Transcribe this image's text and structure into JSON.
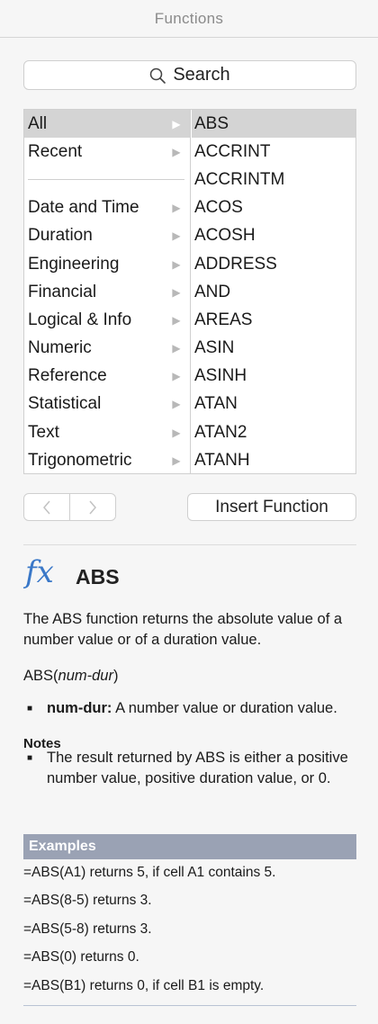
{
  "panel": {
    "title": "Functions"
  },
  "search": {
    "label": "Search",
    "icon": "search-icon"
  },
  "categories": [
    {
      "label": "All",
      "selected": true
    },
    {
      "label": "Recent",
      "selected": false
    },
    {
      "separator": true
    },
    {
      "label": "Date and Time",
      "selected": false
    },
    {
      "label": "Duration",
      "selected": false
    },
    {
      "label": "Engineering",
      "selected": false
    },
    {
      "label": "Financial",
      "selected": false
    },
    {
      "label": "Logical & Info",
      "selected": false
    },
    {
      "label": "Numeric",
      "selected": false
    },
    {
      "label": "Reference",
      "selected": false
    },
    {
      "label": "Statistical",
      "selected": false
    },
    {
      "label": "Text",
      "selected": false
    },
    {
      "label": "Trigonometric",
      "selected": false
    }
  ],
  "functions": [
    {
      "label": "ABS",
      "selected": true
    },
    {
      "label": "ACCRINT",
      "selected": false
    },
    {
      "label": "ACCRINTM",
      "selected": false
    },
    {
      "label": "ACOS",
      "selected": false
    },
    {
      "label": "ACOSH",
      "selected": false
    },
    {
      "label": "ADDRESS",
      "selected": false
    },
    {
      "label": "AND",
      "selected": false
    },
    {
      "label": "AREAS",
      "selected": false
    },
    {
      "label": "ASIN",
      "selected": false
    },
    {
      "label": "ASINH",
      "selected": false
    },
    {
      "label": "ATAN",
      "selected": false
    },
    {
      "label": "ATAN2",
      "selected": false
    },
    {
      "label": "ATANH",
      "selected": false
    }
  ],
  "nav": {
    "back_glyph": "<",
    "forward_glyph": ">"
  },
  "insert_button": {
    "label": "Insert Function"
  },
  "detail": {
    "fx_glyph": "fx",
    "name": "ABS",
    "description": "The ABS function returns the absolute value of a number value or of a duration value.",
    "syntax_prefix": "ABS(",
    "syntax_arg": "num-dur",
    "syntax_suffix": ")",
    "arg_name": "num-dur:",
    "arg_desc": " A number value or duration value.",
    "notes_heading": "Notes",
    "note": "The result returned by ABS is either a positive number value, positive duration value, or 0.",
    "examples_heading": "Examples",
    "examples": [
      "=ABS(A1) returns 5, if cell A1 contains 5.",
      "=ABS(8-5) returns 3.",
      "=ABS(5-8) returns 3.",
      "=ABS(0) returns 0.",
      "=ABS(B1) returns 0, if cell B1 is empty."
    ]
  },
  "colors": {
    "accent_fx": "#3a78c8",
    "selection": "#d4d4d4",
    "examples_bar": "#9aa2b4"
  }
}
